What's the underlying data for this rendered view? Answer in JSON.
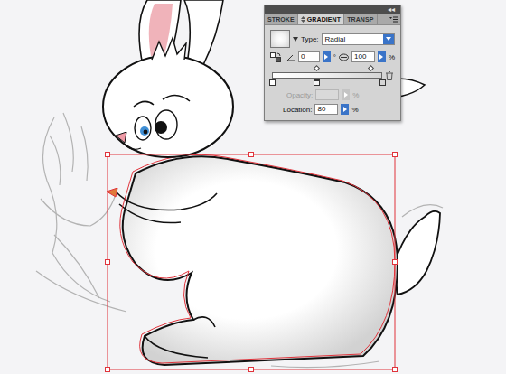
{
  "panel": {
    "collapse": "◂◂",
    "tabs": [
      {
        "label": "STROKE",
        "selected": false
      },
      {
        "label": "GRADIENT",
        "selected": true
      },
      {
        "label": "TRANSP",
        "selected": false
      }
    ],
    "type": {
      "label": "Type:",
      "value": "Radial"
    },
    "angle": {
      "value": "0",
      "unit": "°"
    },
    "aspect": {
      "value": "100",
      "unit": "%"
    },
    "gradient": {
      "midpoints": [
        0.4,
        0.89
      ],
      "stops": [
        {
          "location": 0,
          "color": "#ffffff",
          "selected": false
        },
        {
          "location": 0.4,
          "color": "#f4f4f4",
          "selected": true
        },
        {
          "location": 1,
          "color": "#d4d4d4",
          "selected": false
        }
      ]
    },
    "opacity": {
      "label": "Opacity:",
      "value": "",
      "unit": "%",
      "disabled": true
    },
    "location": {
      "label": "Location:",
      "value": "80",
      "unit": "%"
    }
  }
}
